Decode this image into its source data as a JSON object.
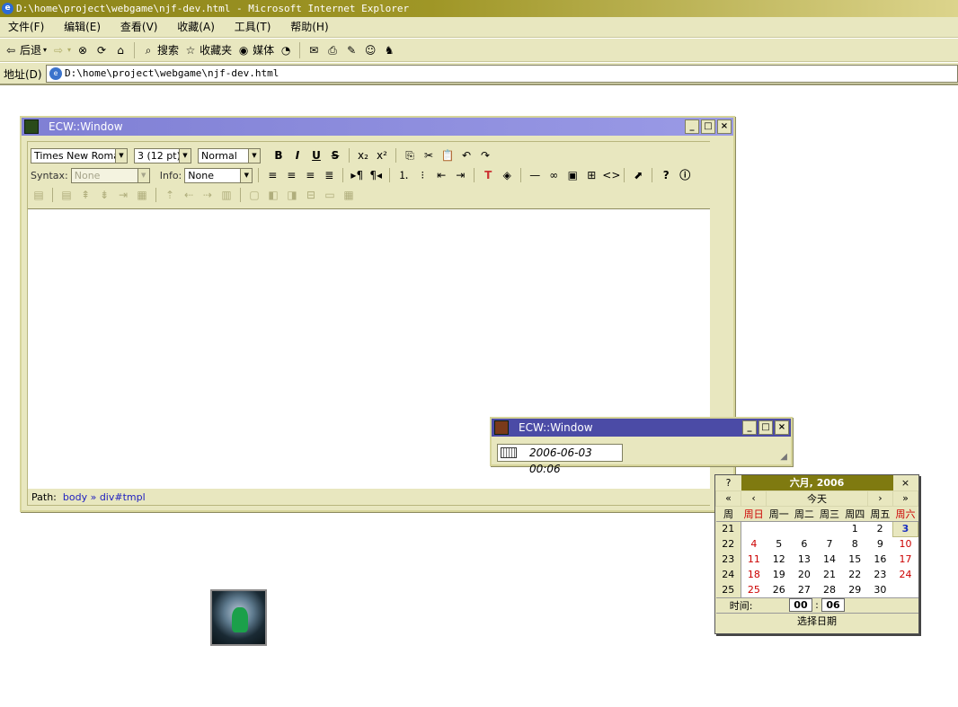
{
  "browser": {
    "title": "D:\\home\\project\\webgame\\njf-dev.html - Microsoft Internet Explorer",
    "menu": [
      "文件(F)",
      "编辑(E)",
      "查看(V)",
      "收藏(A)",
      "工具(T)",
      "帮助(H)"
    ],
    "toolbar": {
      "back": "后退",
      "search": "搜索",
      "favorites": "收藏夹",
      "media": "媒体"
    },
    "address_label": "地址(D)",
    "address_value": "D:\\home\\project\\webgame\\njf-dev.html"
  },
  "editor_window": {
    "title": "ECW::Window",
    "font_select": "Times New Roman",
    "size_select": "3 (12 pt)",
    "format_select": "Normal",
    "syntax_label": "Syntax:",
    "syntax_value": "None",
    "info_label": "Info:",
    "info_value": "None",
    "path_label": "Path:",
    "path_items": [
      "body",
      "div#tmpl"
    ],
    "path_sep": "»"
  },
  "date_window": {
    "title": "ECW::Window",
    "value": "2006-06-03 00:06"
  },
  "calendar": {
    "help": "?",
    "title": "六月, 2006",
    "close": "×",
    "today_label": "今天",
    "nav": {
      "prev_year": "«",
      "prev_month": "‹",
      "next_month": "›",
      "next_year": "»"
    },
    "weekday_header": [
      "周",
      "周日",
      "周一",
      "周二",
      "周三",
      "周四",
      "周五",
      "周六"
    ],
    "weeks": [
      [
        "21",
        "",
        "",
        "",
        "",
        "1",
        "2",
        "3"
      ],
      [
        "22",
        "4",
        "5",
        "6",
        "7",
        "8",
        "9",
        "10"
      ],
      [
        "23",
        "11",
        "12",
        "13",
        "14",
        "15",
        "16",
        "17"
      ],
      [
        "24",
        "18",
        "19",
        "20",
        "21",
        "22",
        "23",
        "24"
      ],
      [
        "25",
        "25",
        "26",
        "27",
        "28",
        "29",
        "30",
        ""
      ]
    ],
    "time_label": "时间:",
    "hour": "00",
    "minute": "06",
    "time_sep": ":",
    "footer": "选择日期"
  },
  "colors": {
    "accent": "#7f7a10",
    "panel": "#e8e7bf",
    "caption": "#8c8cdc",
    "weekend": "#cc0000"
  }
}
